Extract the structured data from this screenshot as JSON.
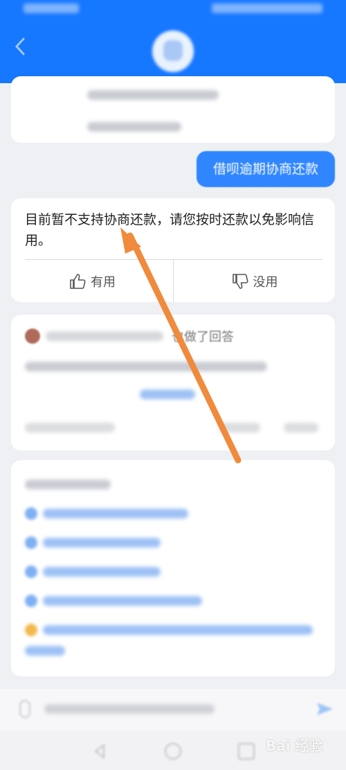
{
  "chat": {
    "user_message": "借呗逾期协商还款",
    "bot_answer": "目前暂不支持协商还款，请您按时还款以免影响信用。",
    "feedback": {
      "useful_label": "有用",
      "useless_label": "没用"
    }
  },
  "comment": {
    "title_suffix": "也做了回答"
  },
  "watermark": {
    "text": "Bai 经验"
  },
  "colors": {
    "header_blue": "#1677ff",
    "user_bubble": "#2f86ff",
    "annotation_arrow": "#f08a3c"
  },
  "icons": [
    "back-icon",
    "thumbs-up-icon",
    "thumbs-down-icon",
    "voice-icon",
    "send-icon"
  ]
}
